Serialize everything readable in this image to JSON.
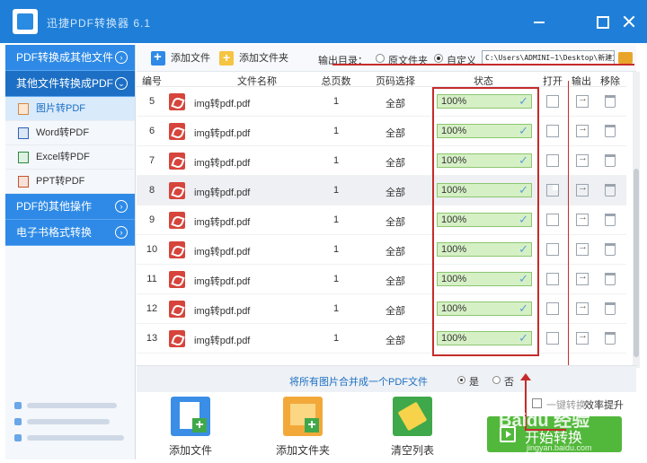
{
  "window": {
    "title": "迅捷PDF转换器 6.1"
  },
  "sidebar": {
    "categories": [
      {
        "label": "PDF转换成其他文件"
      },
      {
        "label": "其他文件转换成PDF"
      },
      {
        "label": "PDF的其他操作"
      },
      {
        "label": "电子书格式转换"
      }
    ],
    "items": [
      {
        "label": "图片转PDF",
        "icon": "image-file-icon"
      },
      {
        "label": "Word转PDF",
        "icon": "word-file-icon"
      },
      {
        "label": "Excel转PDF",
        "icon": "excel-file-icon"
      },
      {
        "label": "PPT转PDF",
        "icon": "ppt-file-icon"
      }
    ]
  },
  "toolbar": {
    "add_file": "添加文件",
    "add_folder": "添加文件夹",
    "output_label": "输出目录：",
    "opt_source": "原文件夹",
    "opt_custom": "自定义",
    "path": "C:\\Users\\ADMINI~1\\Desktop\\新建文"
  },
  "table": {
    "headers": [
      "编号",
      "文件名称",
      "总页数",
      "页码选择",
      "状态",
      "打开",
      "输出",
      "移除"
    ],
    "rows": [
      {
        "num": "5",
        "name": "img转pdf.pdf",
        "pages": "1",
        "range": "全部",
        "status": "100%",
        "progress": 1.0
      },
      {
        "num": "6",
        "name": "img转pdf.pdf",
        "pages": "1",
        "range": "全部",
        "status": "100%",
        "progress": 1.0
      },
      {
        "num": "7",
        "name": "img转pdf.pdf",
        "pages": "1",
        "range": "全部",
        "status": "100%",
        "progress": 1.0
      },
      {
        "num": "8",
        "name": "img转pdf.pdf",
        "pages": "1",
        "range": "全部",
        "status": "100%",
        "progress": 1.0
      },
      {
        "num": "9",
        "name": "img转pdf.pdf",
        "pages": "1",
        "range": "全部",
        "status": "100%",
        "progress": 1.0
      },
      {
        "num": "10",
        "name": "img转pdf.pdf",
        "pages": "1",
        "range": "全部",
        "status": "100%",
        "progress": 1.0
      },
      {
        "num": "11",
        "name": "img转pdf.pdf",
        "pages": "1",
        "range": "全部",
        "status": "100%",
        "progress": 1.0
      },
      {
        "num": "12",
        "name": "img转pdf.pdf",
        "pages": "1",
        "range": "全部",
        "status": "100%",
        "progress": 1.0
      },
      {
        "num": "13",
        "name": "img转pdf.pdf",
        "pages": "1",
        "range": "全部",
        "status": "100%",
        "progress": 1.0
      }
    ]
  },
  "merge": {
    "label": "将所有图片合并成一个PDF文件",
    "yes": "是",
    "no": "否"
  },
  "bottom": {
    "add_file": "添加文件",
    "add_folder": "添加文件夹",
    "clear_list": "清空列表",
    "eff_prefix": "一键转换",
    "eff_label": "效率提升",
    "start": "开始转换",
    "start_sub": "jingyan.baidu.com"
  },
  "watermark": "Baidu 经验",
  "colors": {
    "accent": "#1f7fd8",
    "annotation": "#c62b2b",
    "progress": "#d6f0c6",
    "start": "#52b83b"
  }
}
